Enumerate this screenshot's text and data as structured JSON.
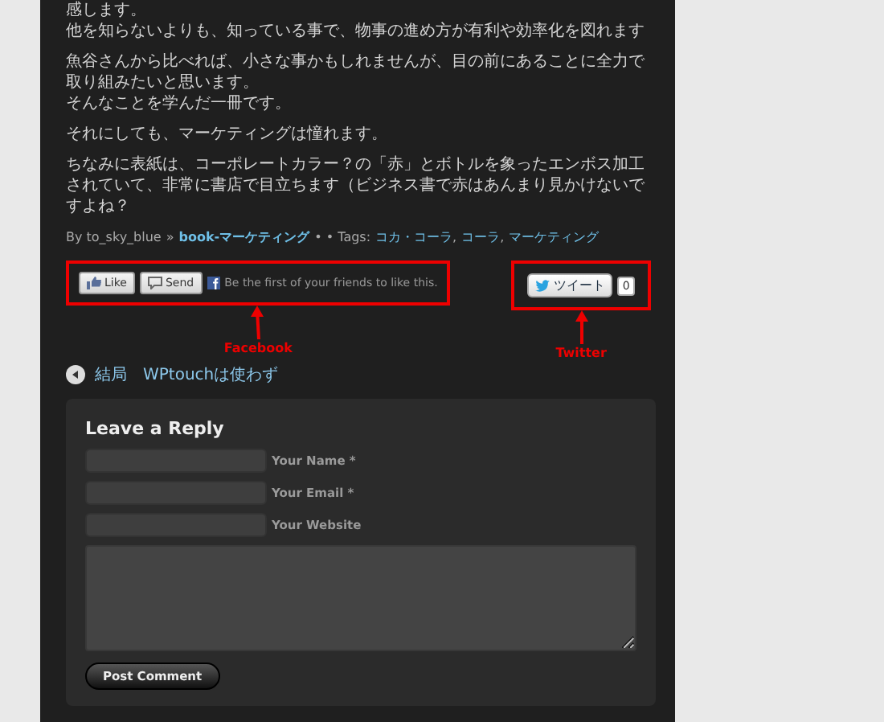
{
  "article": {
    "paragraphs": [
      [
        "感します。",
        "他を知らないよりも、知っている事で、物事の進め方が有利や効率化を図れます"
      ],
      [
        "魚谷さんから比べれば、小さな事かもしれませんが、目の前にあることに全力で取り組みたいと思います。",
        "そんなことを学んだ一冊です。"
      ],
      [
        "それにしても、マーケティングは憧れます。"
      ],
      [
        "ちなみに表紙は、コーポレートカラー？の「赤」とボトルを象ったエンボス加工されていて、非常に書店で目立ちます（ビジネス書で赤はあんまり見かけないですよね？"
      ]
    ],
    "meta": {
      "by": "By to_sky_blue",
      "separator": "»",
      "category": "book-マーケティング",
      "tags_label": "• • Tags:",
      "tag_separator": ",",
      "tags": [
        "コカ・コーラ",
        "コーラ",
        "マーケティング"
      ]
    }
  },
  "facebook": {
    "like": "Like",
    "send": "Send",
    "social_text": "Be the first of your friends to like this.",
    "annotation": "Facebook"
  },
  "twitter": {
    "tweet": "ツイート",
    "count": "0",
    "annotation": "Twitter"
  },
  "nav": {
    "previous": "結局　WPtouchは使わず"
  },
  "reply": {
    "title": "Leave a Reply",
    "fields": [
      {
        "label": "Your Name *"
      },
      {
        "label": "Your Email *"
      },
      {
        "label": "Your Website"
      }
    ],
    "submit": "Post Comment"
  }
}
